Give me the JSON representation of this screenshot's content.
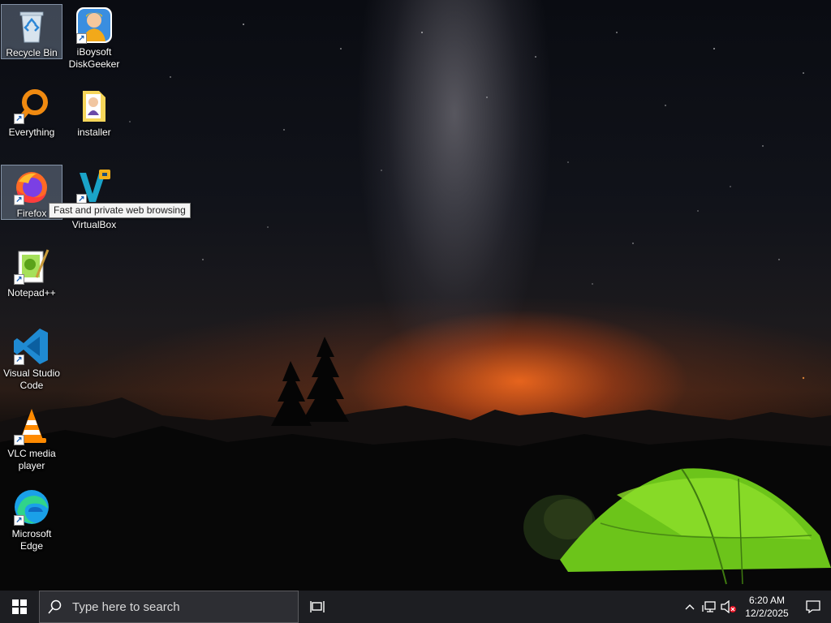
{
  "desktop": {
    "icons": [
      {
        "name": "recycle-bin",
        "label": "Recycle Bin",
        "icon": "recycle-bin-icon"
      },
      {
        "name": "iboysoft",
        "label": "iBoysoft DiskGeeker",
        "icon": "iboysoft-diskgeeker-icon"
      },
      {
        "name": "everything",
        "label": "Everything",
        "icon": "everything-search-icon"
      },
      {
        "name": "installer",
        "label": "installer",
        "icon": "installer-folder-icon"
      },
      {
        "name": "firefox",
        "label": "Firefox",
        "icon": "firefox-icon"
      },
      {
        "name": "virtualbox",
        "label": "VirtualBox",
        "icon": "virtualbox-icon"
      },
      {
        "name": "notepadpp",
        "label": "Notepad++",
        "icon": "notepad-plus-plus-icon"
      },
      {
        "name": "vscode",
        "label": "Visual Studio Code",
        "icon": "visual-studio-code-icon"
      },
      {
        "name": "vlc",
        "label": "VLC media player",
        "icon": "vlc-icon"
      },
      {
        "name": "edge",
        "label": "Microsoft Edge",
        "icon": "microsoft-edge-icon"
      }
    ],
    "tooltip": "Fast and private web browsing"
  },
  "taskbar": {
    "search_placeholder": "Type here to search",
    "time": "6:20 AM",
    "date": "12/2/2025"
  },
  "colors": {
    "taskbar_bg": "#1d1e22",
    "search_bg": "#2d2e33",
    "tent_green": "#7ad61e"
  }
}
